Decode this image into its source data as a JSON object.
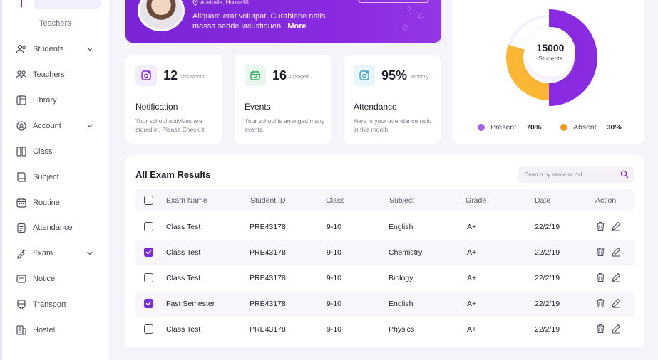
{
  "sidebar": {
    "sub_item": "Teachers",
    "items": [
      {
        "label": "Students",
        "icon": "users-icon",
        "chevron": true
      },
      {
        "label": "Teachers",
        "icon": "teachers-icon",
        "chevron": false
      },
      {
        "label": "Library",
        "icon": "library-icon",
        "chevron": false
      },
      {
        "label": "Account",
        "icon": "account-icon",
        "chevron": true
      },
      {
        "label": "Class",
        "icon": "class-icon",
        "chevron": false
      },
      {
        "label": "Subject",
        "icon": "book-icon",
        "chevron": false
      },
      {
        "label": "Routine",
        "icon": "calendar-icon",
        "chevron": false
      },
      {
        "label": "Attendance",
        "icon": "clipboard-icon",
        "chevron": false
      },
      {
        "label": "Exam",
        "icon": "exam-icon",
        "chevron": true
      },
      {
        "label": "Notice",
        "icon": "notice-icon",
        "chevron": false
      },
      {
        "label": "Transport",
        "icon": "bus-icon",
        "chevron": false
      },
      {
        "label": "Hostel",
        "icon": "building-icon",
        "chevron": false
      }
    ]
  },
  "banner": {
    "location": "Australia, House10",
    "message": "Aliquam erat volutpat. Curabiene natis massa sedde lacustiquen...",
    "more": "More"
  },
  "stats": [
    {
      "value": "12",
      "suffix": "This Month",
      "title": "Notification",
      "desc": "Your school activities are stored in. Please Check it.",
      "color": "#7a2bd8",
      "bg": "#f3ecfd",
      "icon": "notification-icon"
    },
    {
      "value": "16",
      "suffix": "Arranged",
      "title": "Events",
      "desc": "Your school is arranged many events.",
      "color": "#2fae5e",
      "bg": "#e9f7ef",
      "icon": "events-icon"
    },
    {
      "value": "95%",
      "suffix": "Monthly",
      "title": "Attendance",
      "desc": "Here is your attendance ratio in this month.",
      "color": "#3aa6c9",
      "bg": "#e8f5fa",
      "icon": "attendance-icon"
    }
  ],
  "students": {
    "total": "15000",
    "label": "Students",
    "legend": [
      {
        "name": "Present",
        "pct": "70%",
        "color": "#a55fe8"
      },
      {
        "name": "Absent",
        "pct": "30%",
        "color": "#f39a1e"
      }
    ],
    "present_color": "#8a2be2",
    "absent_color": "#fbb634"
  },
  "results": {
    "title": "All Exam Results",
    "search_placeholder": "Search by name or roll",
    "columns": [
      "Exam Name",
      "Student ID",
      "Class",
      "Subject",
      "Grade",
      "Date",
      "Action"
    ],
    "rows": [
      {
        "checked": false,
        "exam": "Class Test",
        "id": "PRE43178",
        "class": "9-10",
        "subject": "English",
        "grade": "A+",
        "date": "22/2/19"
      },
      {
        "checked": true,
        "exam": "Class Test",
        "id": "PRE43178",
        "class": "9-10",
        "subject": "Chemistry",
        "grade": "A+",
        "date": "22/2/19"
      },
      {
        "checked": false,
        "exam": "Class Test",
        "id": "PRE43178",
        "class": "9-10",
        "subject": "Biology",
        "grade": "A+",
        "date": "22/2/19"
      },
      {
        "checked": true,
        "exam": "Fast Semester",
        "id": "PRE43178",
        "class": "9-10",
        "subject": "English",
        "grade": "A+",
        "date": "22/2/19"
      },
      {
        "checked": false,
        "exam": "Class Test",
        "id": "PRE43178",
        "class": "9-10",
        "subject": "Physics",
        "grade": "A+",
        "date": "22/2/19"
      }
    ]
  }
}
